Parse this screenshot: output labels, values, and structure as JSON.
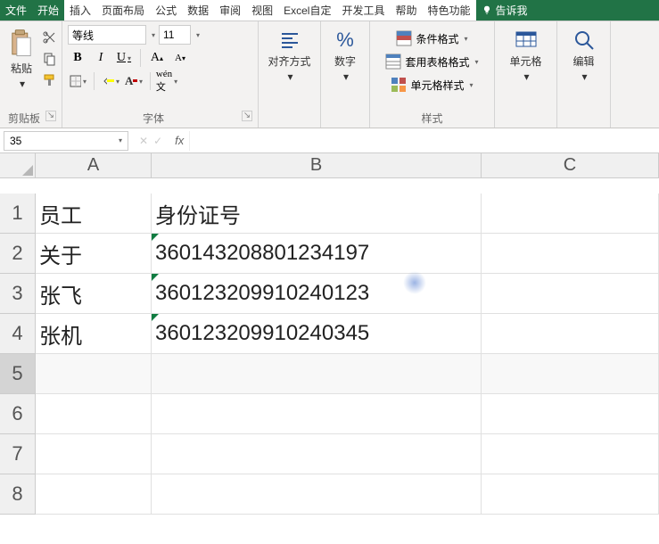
{
  "tabs": {
    "file": "文件",
    "home": "开始",
    "insert": "插入",
    "layout": "页面布局",
    "formulas": "公式",
    "data": "数据",
    "review": "审阅",
    "view": "视图",
    "excel_auto": "Excel自定",
    "dev": "开发工具",
    "help": "帮助",
    "special": "特色功能",
    "tell_me": "告诉我"
  },
  "ribbon": {
    "clipboard": {
      "paste": "粘贴",
      "label": "剪贴板"
    },
    "font": {
      "name": "等线",
      "size": "11",
      "label": "字体"
    },
    "align": {
      "label": "对齐方式"
    },
    "number": {
      "label": "数字",
      "percent": "%"
    },
    "styles": {
      "cond_fmt": "条件格式",
      "table_fmt": "套用表格格式",
      "cell_styles": "单元格样式",
      "label": "样式"
    },
    "cells": {
      "label": "单元格"
    },
    "editing": {
      "label": "编辑"
    }
  },
  "name_box": "35",
  "columns": [
    "A",
    "B",
    "C"
  ],
  "rows": [
    "1",
    "2",
    "3",
    "4",
    "5",
    "6",
    "7",
    "8"
  ],
  "sheet_data": {
    "A1": "员工",
    "B1": "身份证号",
    "A2": "关于",
    "B2": "360143208801234197",
    "A3": "张飞",
    "B3": "360123209910240123",
    "A4": "张机",
    "B4": "360123209910240345"
  }
}
